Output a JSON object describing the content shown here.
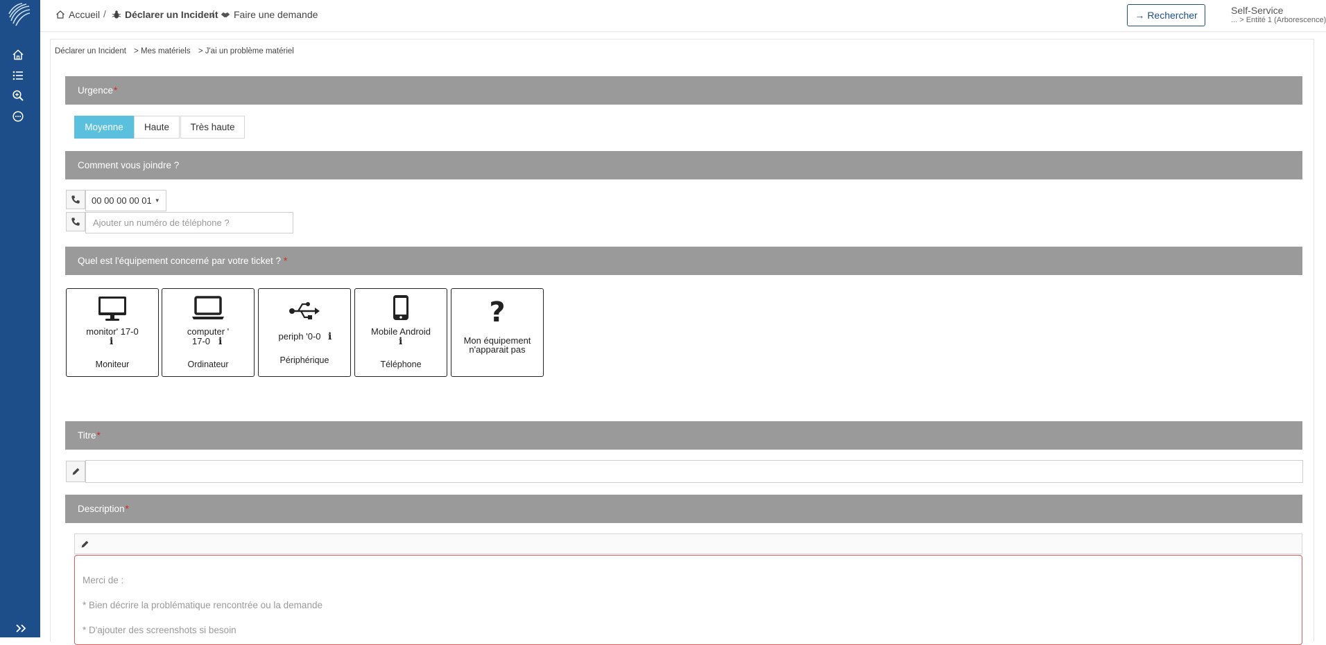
{
  "header": {
    "breadcrumb": {
      "home": "Accueil",
      "incident": "Déclarer un Incident",
      "request": "Faire une demande",
      "separator": "/"
    },
    "search_label": "Rechercher",
    "profile_name": "Self-Service",
    "profile_entity": "... > Entité 1 (Arborescence)"
  },
  "sidebar": {
    "icons": [
      "home-icon",
      "list-icon",
      "zoom-search-icon",
      "more-circle-icon",
      "double-chevron-right-icon"
    ]
  },
  "path": [
    "Déclarer un Incident",
    "> Mes matériels",
    "> J'ai un problème matériel"
  ],
  "sections": {
    "urgency": {
      "label": "Urgence",
      "required": "*"
    },
    "contact": {
      "label": "Comment vous joindre ?"
    },
    "equipment": {
      "label": "Quel est l'équipement concerné par votre ticket ?",
      "required": "*"
    },
    "title": {
      "label": "Titre",
      "required": "*"
    },
    "description": {
      "label": "Description",
      "required": "*"
    }
  },
  "urgency": {
    "options": [
      "Moyenne",
      "Haute",
      "Très haute"
    ],
    "selected": "Moyenne"
  },
  "contact": {
    "phone_value": "00 00 00 00 01",
    "phone_placeholder": "Ajouter un numéro de téléphone ?"
  },
  "equipment": {
    "cards": [
      {
        "name_line1": "monitor' 17-0",
        "name_line2": "",
        "info": "i",
        "type": "Moniteur",
        "icon": "monitor-icon"
      },
      {
        "name_line1": "computer '",
        "name_line2": "17-0",
        "info": "i",
        "type": "Ordinateur",
        "icon": "laptop-icon"
      },
      {
        "name_line1": "periph '0-0",
        "name_line2": "",
        "info": "i",
        "type": "Périphérique",
        "icon": "usb-icon"
      },
      {
        "name_line1": "Mobile Android",
        "name_line2": "",
        "info": "i",
        "type": "Téléphone",
        "icon": "mobile-phone-icon"
      },
      {
        "name_line1": "Mon équipement",
        "name_line2": "n'apparait pas",
        "info": "",
        "type": "",
        "icon": "question-mark-icon"
      }
    ]
  },
  "title_field": {
    "value": ""
  },
  "description": {
    "placeholder_lines": [
      "Merci de :",
      "* Bien décrire la problématique rencontrée ou la demande",
      "* D'ajouter des screenshots si besoin"
    ]
  },
  "colors": {
    "sidebar": "#1d4e89",
    "section_header": "#9a9a9a",
    "selected_urgency": "#5bc0de",
    "required": "#d9241e",
    "avatar": "#1d9bd8"
  }
}
